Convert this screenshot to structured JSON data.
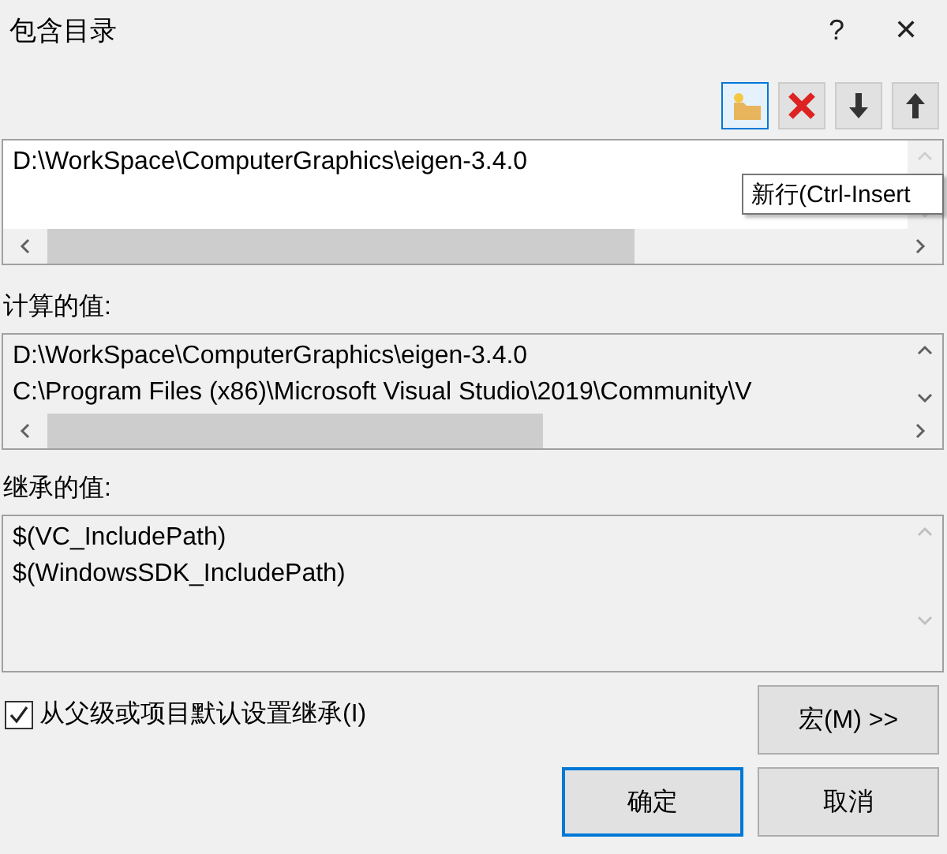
{
  "window": {
    "title": "包含目录",
    "help": "?",
    "close": "✕"
  },
  "toolbar": {
    "buttons": [
      {
        "kind": "new-folder",
        "selected": true
      },
      {
        "kind": "delete",
        "selected": false
      },
      {
        "kind": "down",
        "selected": false
      },
      {
        "kind": "up",
        "selected": false
      }
    ]
  },
  "tooltip": "新行(Ctrl-Insert",
  "entries": {
    "lines": [
      "D:\\WorkSpace\\ComputerGraphics\\eigen-3.4.0"
    ]
  },
  "computed": {
    "label": "计算的值:",
    "lines": [
      "D:\\WorkSpace\\ComputerGraphics\\eigen-3.4.0",
      "C:\\Program Files (x86)\\Microsoft Visual Studio\\2019\\Community\\V"
    ]
  },
  "inherited": {
    "label": "继承的值:",
    "lines": [
      "$(VC_IncludePath)",
      "$(WindowsSDK_IncludePath)"
    ]
  },
  "inherit_checkbox": {
    "label": "从父级或项目默认设置继承(I)",
    "checked": true
  },
  "macro_button": "宏(M) >>",
  "buttons": [
    {
      "label": "确定",
      "selected": true
    },
    {
      "label": "取消",
      "selected": false
    }
  ]
}
